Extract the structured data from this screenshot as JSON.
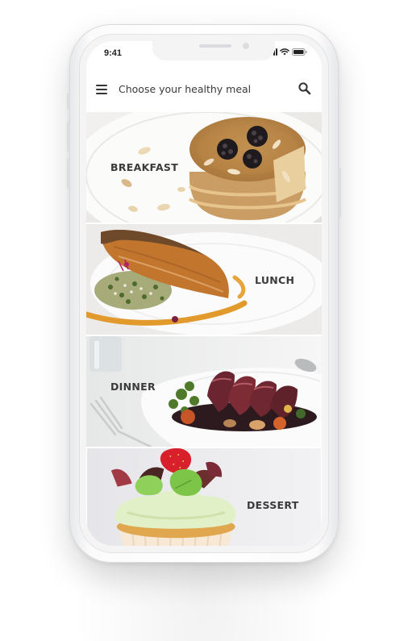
{
  "status_bar": {
    "time": "9:41",
    "icons": [
      "signal-icon",
      "wifi-icon",
      "battery-icon"
    ]
  },
  "header": {
    "title": "Choose your healthy meal",
    "menu_icon": "hamburger-menu-icon",
    "search_icon": "search-icon"
  },
  "meals": [
    {
      "label": "BREAKFAST",
      "image": "pancakes-with-blackberries-and-almonds"
    },
    {
      "label": "LUNCH",
      "image": "grilled-salmon-with-herb-grains"
    },
    {
      "label": "DINNER",
      "image": "sliced-steak-with-roasted-vegetables"
    },
    {
      "label": "DESSERT",
      "image": "cupcake-with-green-frosting-and-strawberry"
    }
  ],
  "colors": {
    "label_text": "#3b3b3b",
    "screen_background": "#ffffff",
    "phone_frame": "#f4f4f5"
  }
}
